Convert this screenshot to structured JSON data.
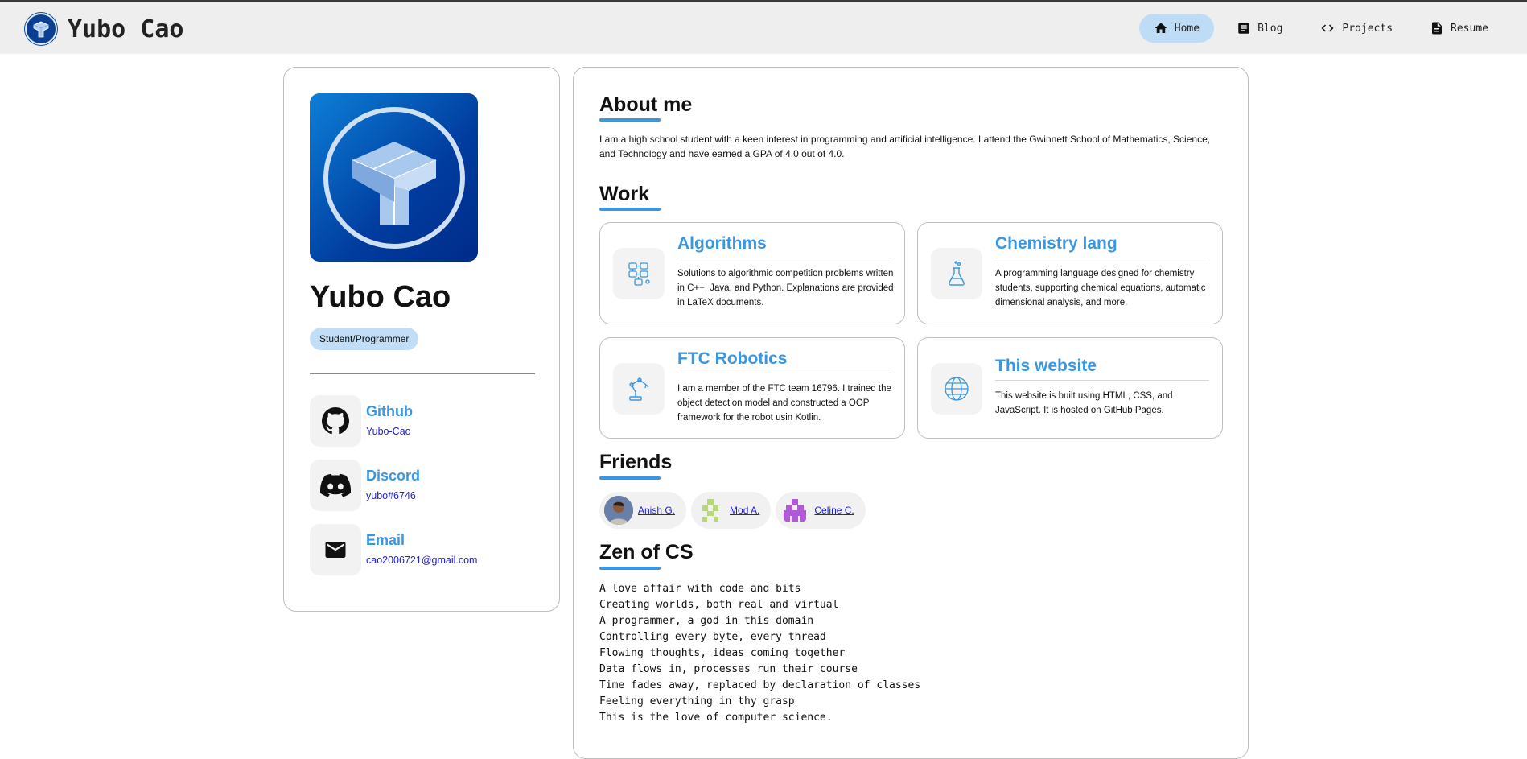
{
  "header": {
    "brand_name": "Yubo Cao",
    "nav": [
      {
        "label": "Home",
        "icon": "home-icon",
        "active": true
      },
      {
        "label": "Blog",
        "icon": "article-icon",
        "active": false
      },
      {
        "label": "Projects",
        "icon": "code-icon",
        "active": false
      },
      {
        "label": "Resume",
        "icon": "document-icon",
        "active": false
      }
    ]
  },
  "profile": {
    "name": "Yubo Cao",
    "role": "Student/Programmer",
    "contacts": [
      {
        "title": "Github",
        "value": "Yubo-Cao",
        "icon": "github-icon"
      },
      {
        "title": "Discord",
        "value": "yubo#6746",
        "icon": "discord-icon"
      },
      {
        "title": "Email",
        "value": "cao2006721@gmail.com",
        "icon": "mail-icon"
      }
    ]
  },
  "about": {
    "title": "About me",
    "text": "I am a high school student with a keen interest in programming and artificial intelligence. I attend the Gwinnett School of Mathematics, Science, and Technology and have earned a GPA of 4.0 out of 4.0."
  },
  "work": {
    "title": "Work",
    "items": [
      {
        "title": "Algorithms",
        "desc": "Solutions to algorithmic competition problems written in C++, Java, and Python. Explanations are provided in LaTeX documents.",
        "icon": "algorithm-icon"
      },
      {
        "title": "Chemistry lang",
        "desc": "A programming language designed for chemistry students, supporting chemical equations, automatic dimensional analysis, and more.",
        "icon": "flask-icon"
      },
      {
        "title": "FTC Robotics",
        "desc": "I am a member of the FTC team 16796. I trained the object detection model and constructed a OOP framework for the robot usin Kotlin.",
        "icon": "robot-arm-icon"
      },
      {
        "title": "This website",
        "desc": "This website is built using HTML, CSS, and JavaScript. It is hosted on GitHub Pages.",
        "icon": "globe-icon"
      }
    ]
  },
  "friends": {
    "title": "Friends",
    "items": [
      {
        "name": "Anish G.",
        "avatar": "photo-avatar"
      },
      {
        "name": "Mod A.",
        "avatar": "identicon-green",
        "color": "#b7d77a"
      },
      {
        "name": "Celine C.",
        "avatar": "identicon-purple",
        "color": "#b05ad8"
      }
    ]
  },
  "zen": {
    "title": "Zen of CS",
    "lines": [
      "A love affair with code and bits",
      "Creating worlds, both real and virtual",
      "A programmer, a god in this domain",
      "Controlling every byte, every thread",
      "Flowing thoughts, ideas coming together",
      "Data flows in, processes run their course",
      "Time fades away, replaced by declaration of classes",
      "Feeling everything in thy grasp",
      "This is the love of computer science."
    ]
  },
  "colors": {
    "accent": "#3a96e0",
    "active_nav": "#bfdcf7",
    "link": "#2020d8"
  }
}
